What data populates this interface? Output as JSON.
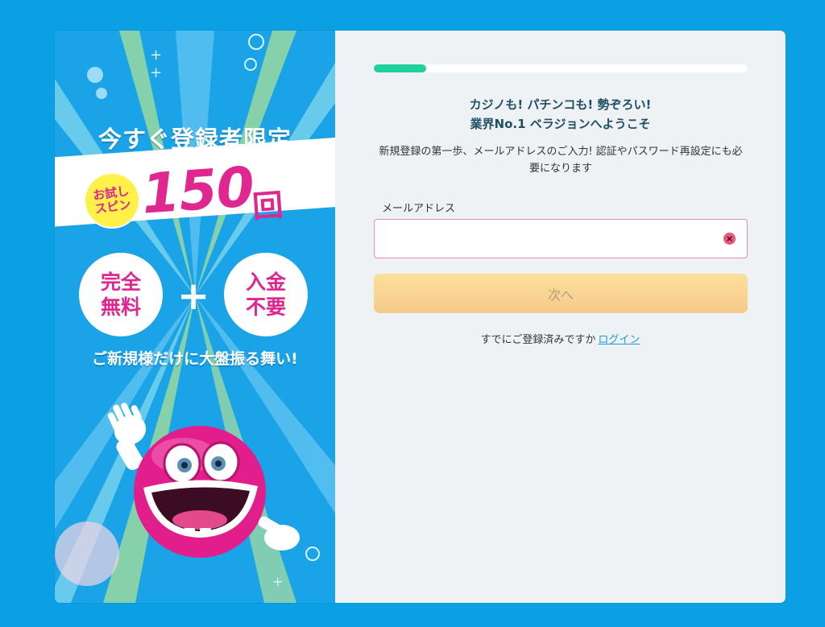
{
  "promo": {
    "headline": "今すぐ登録者限定",
    "trial_badge_line1": "お試し",
    "trial_badge_line2": "スピン",
    "spins_count": "150",
    "spins_unit": "回",
    "badge_left_line1": "完全",
    "badge_left_line2": "無料",
    "plus": "+",
    "badge_right_line1": "入金",
    "badge_right_line2": "不要",
    "tagline": "ご新規様だけに大盤振る舞い!",
    "colors": {
      "background": "#1aa3e6",
      "accent_pink": "#e0268f",
      "badge_yellow": "#fff04a"
    }
  },
  "form": {
    "progress_fraction": 0.14,
    "welcome_line1": "カジノも! パチンコも! 勢ぞろい!",
    "welcome_line2": "業界No.1 ベラジョンへようこそ",
    "subtitle": "新規登録の第一歩、メールアドレスのご入力! 認証やパスワード再設定にも必要になります",
    "email_label": "メールアドレス",
    "email_value": "",
    "clear_icon": "×",
    "next_label": "次へ",
    "login_prompt": "すでにご登録済みですか",
    "login_link": "ログイン",
    "colors": {
      "progress": "#1fd19d",
      "error_border": "#e98fa3",
      "button": "#f5c98a",
      "link": "#1a9cd3"
    }
  }
}
